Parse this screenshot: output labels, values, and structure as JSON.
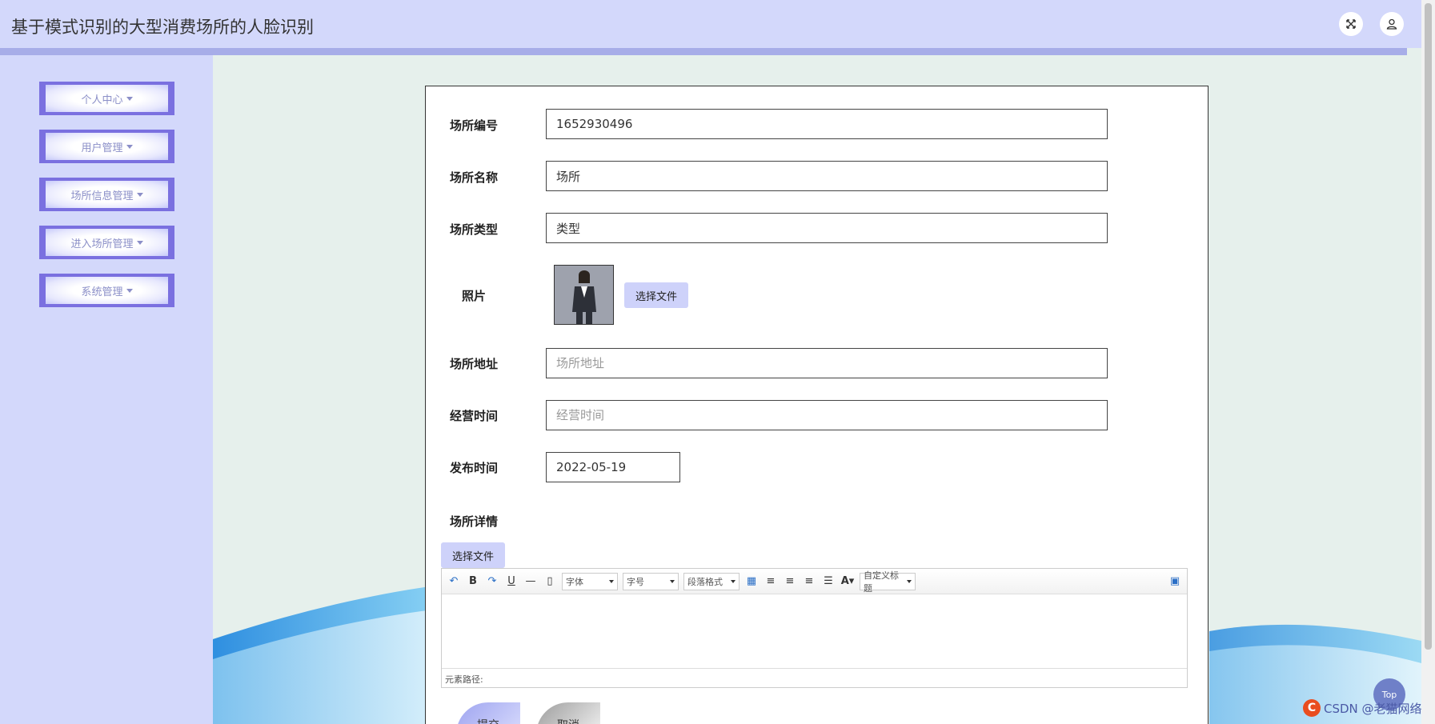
{
  "header": {
    "title": "基于模式识别的大型消费场所的人脸识别",
    "fullscreen_icon": "fullscreen-icon",
    "user_icon": "user-icon"
  },
  "sidebar": {
    "items": [
      {
        "label": "个人中心"
      },
      {
        "label": "用户管理"
      },
      {
        "label": "场所信息管理"
      },
      {
        "label": "进入场所管理"
      },
      {
        "label": "系统管理"
      }
    ]
  },
  "form": {
    "code": {
      "label": "场所编号",
      "value": "1652930496"
    },
    "name": {
      "label": "场所名称",
      "value": "场所"
    },
    "type": {
      "label": "场所类型",
      "value": "类型"
    },
    "photo": {
      "label": "照片",
      "button": "选择文件"
    },
    "address": {
      "label": "场所地址",
      "placeholder": "场所地址"
    },
    "hours": {
      "label": "经营时间",
      "placeholder": "经营时间"
    },
    "publish": {
      "label": "发布时间",
      "value": "2022-05-19"
    },
    "detail": {
      "label": "场所详情",
      "button": "选择文件"
    }
  },
  "editor": {
    "font_family": "字体",
    "font_size": "字号",
    "paragraph": "段落格式",
    "custom_title": "自定义标题",
    "element_path": "元素路径:"
  },
  "actions": {
    "submit": "提交",
    "cancel": "取消"
  },
  "misc": {
    "top_button": "Top",
    "watermark": "CSDN @老猫网络"
  },
  "colors": {
    "accent": "#d3d8fb",
    "sidebar_border": "#7a70e0",
    "main_bg": "#e6f0ec"
  }
}
